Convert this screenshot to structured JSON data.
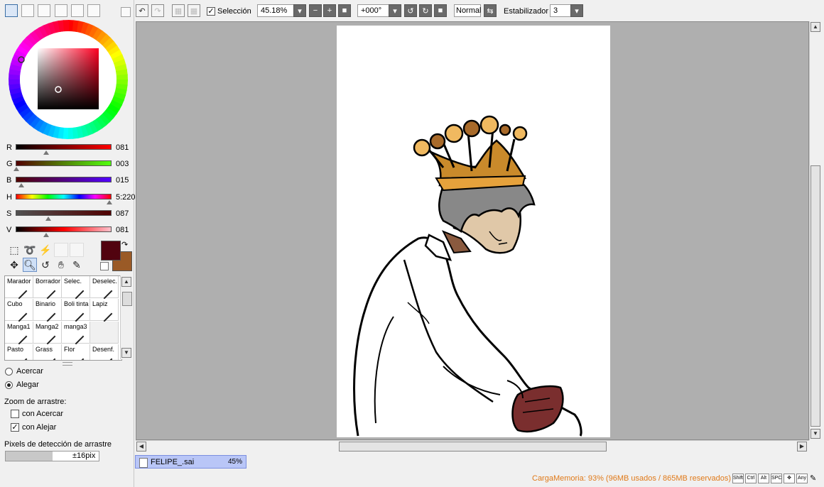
{
  "color_panel": {
    "sliders": [
      {
        "label": "R",
        "value": "081",
        "fraction": 0.32,
        "gradient": "linear-gradient(to right,#000000,#ff0000)"
      },
      {
        "label": "G",
        "value": "003",
        "fraction": 0.01,
        "gradient": "linear-gradient(to right,#510000,#51ff0f)"
      },
      {
        "label": "B",
        "value": "015",
        "fraction": 0.06,
        "gradient": "linear-gradient(to right,#510300,#5103ff)"
      },
      {
        "label": "H",
        "value": "5:220",
        "fraction": 0.98,
        "gradient": "linear-gradient(to right,#ff0000,#ffff00,#00ff00,#00ffff,#0000ff,#ff00ff,#ff0000)"
      },
      {
        "label": "S",
        "value": "087",
        "fraction": 0.34,
        "gradient": "linear-gradient(to right,#515151,#510000)"
      },
      {
        "label": "V",
        "value": "081",
        "fraction": 0.32,
        "gradient": "linear-gradient(to right,#000000,#ff0000,#ffc0cb)"
      }
    ],
    "primary_color": "#51030f",
    "secondary_color": "#9a5a26"
  },
  "brushes": [
    {
      "name": "Marador"
    },
    {
      "name": "Borrador"
    },
    {
      "name": "Selec."
    },
    {
      "name": "Deselec."
    },
    {
      "name": "Cubo"
    },
    {
      "name": "Binario"
    },
    {
      "name": "Boli tinta"
    },
    {
      "name": "Lapiz"
    },
    {
      "name": "Manga1"
    },
    {
      "name": "Manga2"
    },
    {
      "name": "manga3"
    },
    {
      "name": ""
    },
    {
      "name": "Pasto"
    },
    {
      "name": "Grass"
    },
    {
      "name": "Flor"
    },
    {
      "name": "Desenf."
    }
  ],
  "zoom_options": {
    "acercar": "Acercar",
    "alegar": "Alegar",
    "drag_zoom_label": "Zoom de arrastre:",
    "con_acercar": "con Acercar",
    "con_alejar": "con Alejar",
    "drag_pixels_label": "Pixels de detección de arrastre",
    "drag_pixels_value": "±16pix"
  },
  "toolbar": {
    "seleccion_label": "Selección",
    "zoom_value": "45.18%",
    "rotation_value": "+000°",
    "blend_mode": "Normal",
    "stabilizer_label": "Estabilizador",
    "stabilizer_value": "3"
  },
  "document": {
    "filename": "FELIPE_.sai",
    "zoom": "45%"
  },
  "status": {
    "memory": "CargaMemoria: 93% (96MB usados / 865MB reservados)",
    "memory_color": "#e07a1a",
    "keys": [
      "Shift",
      "Ctrl",
      "Alt",
      "SPC",
      "✥",
      "Any"
    ]
  }
}
